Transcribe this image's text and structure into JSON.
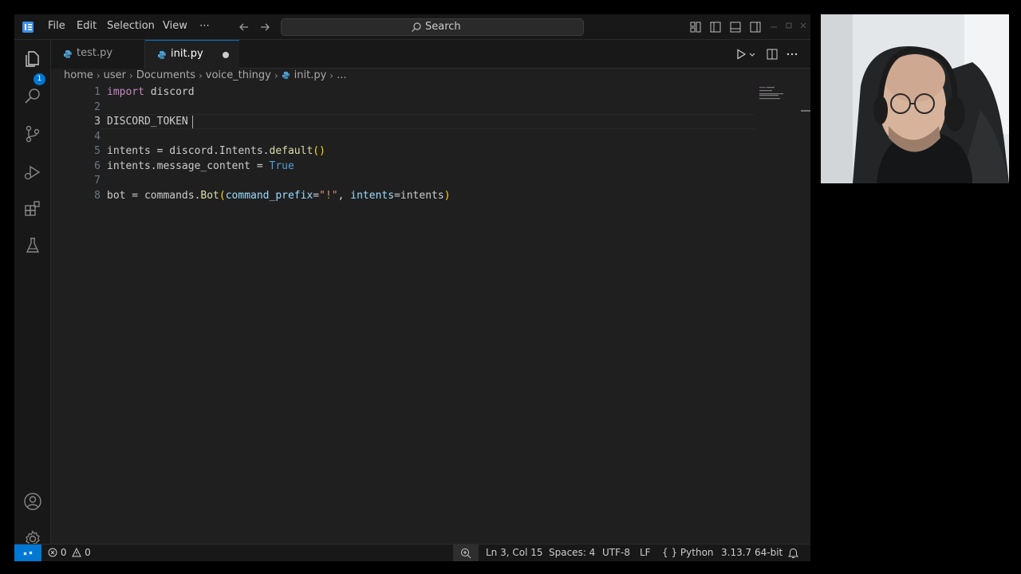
{
  "menu": [
    "File",
    "Edit",
    "Selection",
    "View",
    "⋯"
  ],
  "search": {
    "label": "Search"
  },
  "tabs": [
    {
      "label": "test.py",
      "active": false,
      "dirty": false
    },
    {
      "label": "init.py",
      "active": true,
      "dirty": true
    }
  ],
  "breadcrumb": [
    "home",
    "user",
    "Documents",
    "voice_thingy",
    "init.py",
    "..."
  ],
  "activity": {
    "explorer_badge": "1"
  },
  "editor": {
    "line_numbers": [
      "1",
      "2",
      "3",
      "4",
      "5",
      "6",
      "7",
      "8"
    ],
    "active_line": "3",
    "lines": {
      "l1": {
        "kw": "import",
        "rest": " discord"
      },
      "l3": {
        "text": "DISCORD_TOKEN"
      },
      "l5": {
        "a": "intents = discord.Intents.",
        "fn": "default",
        "paren": "()"
      },
      "l6": {
        "a": "intents.message_content = ",
        "bool": "True"
      },
      "l8": {
        "a": "bot = commands.",
        "fn": "Bot",
        "open": "(",
        "p1": "command_prefix",
        "eq1": "=",
        "str": "\"!\"",
        "comma": ", ",
        "p2": "intents",
        "eq2": "=intents",
        "close": ")"
      }
    }
  },
  "status": {
    "errors": "0",
    "warnings": "0",
    "position": "Ln 3, Col 15",
    "spaces": "Spaces: 4",
    "encoding": "UTF-8",
    "eol": "LF",
    "language": "Python",
    "interpreter": "3.13.7 64-bit"
  },
  "colors": {
    "accent": "#0078d4",
    "editor_bg": "#1f1f1f",
    "keyword": "#c586c0",
    "function": "#dcdcaa",
    "constant": "#569cd6",
    "string": "#ce9178"
  }
}
